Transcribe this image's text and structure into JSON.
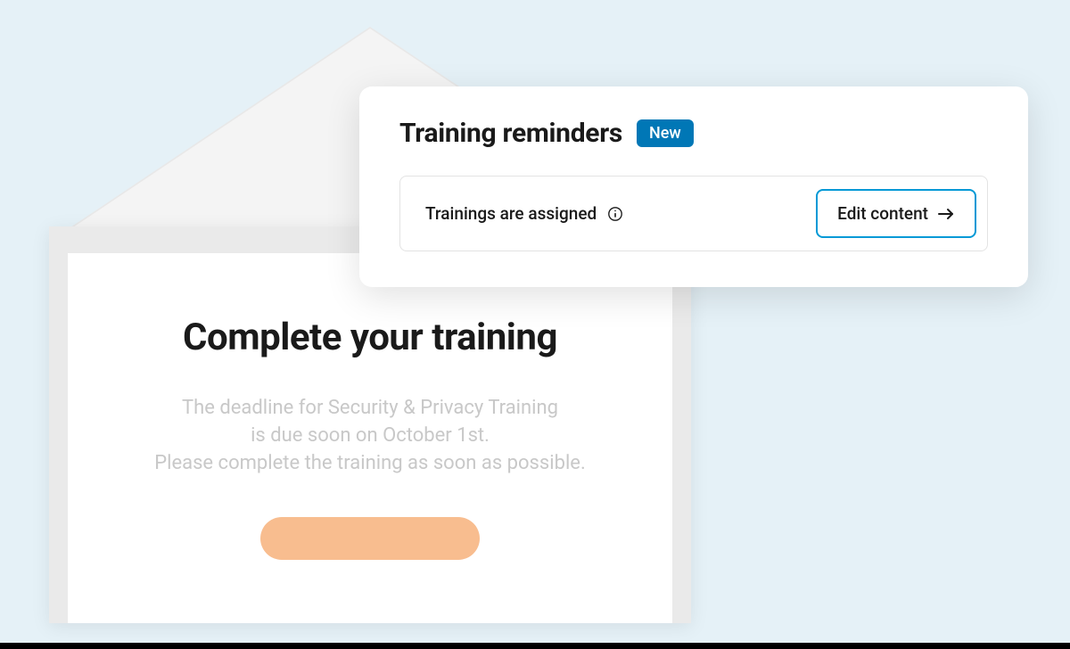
{
  "email": {
    "title": "Complete your training",
    "body_line1": "The deadline for Security & Privacy Training",
    "body_line2": "is due soon on October 1st.",
    "body_line3": "Please complete the training as soon as possible."
  },
  "popup": {
    "title": "Training reminders",
    "badge": "New",
    "row_label": "Trainings are assigned",
    "edit_button": "Edit content"
  }
}
